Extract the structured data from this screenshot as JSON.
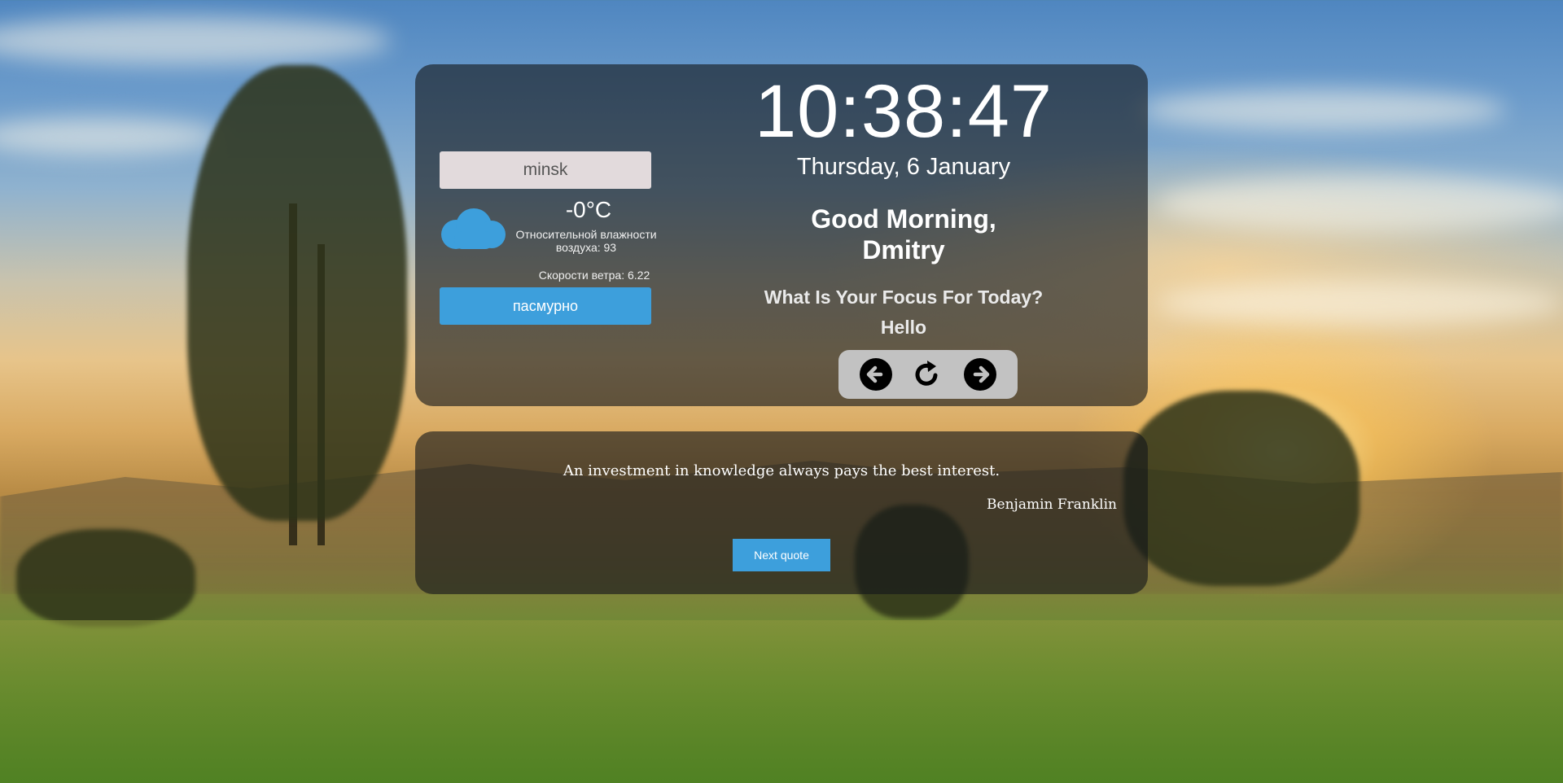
{
  "weather": {
    "city_value": "minsk",
    "icon": "cloud-icon",
    "temperature": "-0°C",
    "humidity": "Относительной влажности воздуха: 93",
    "wind": "Скорости ветра: 6.22",
    "description": "пасмурно"
  },
  "clock": {
    "time": "10:38:47",
    "date": "Thursday, 6 January"
  },
  "greeting": {
    "text": "Good Morning, Dmitry"
  },
  "focus": {
    "question": "What Is Your Focus For Today?",
    "answer": "Hello"
  },
  "controls": {
    "prev_icon": "arrow-left-circle-icon",
    "refresh_icon": "refresh-icon",
    "next_icon": "arrow-right-circle-icon"
  },
  "quote": {
    "text": "An investment in knowledge always pays the best interest.",
    "author": "Benjamin Franklin",
    "button_label": "Next quote"
  },
  "colors": {
    "accent": "#3d9fdc",
    "panel": "rgba(20,22,26,0.62)",
    "input_bg": "#e2dadc",
    "controls_bg": "#c2c2c2"
  }
}
